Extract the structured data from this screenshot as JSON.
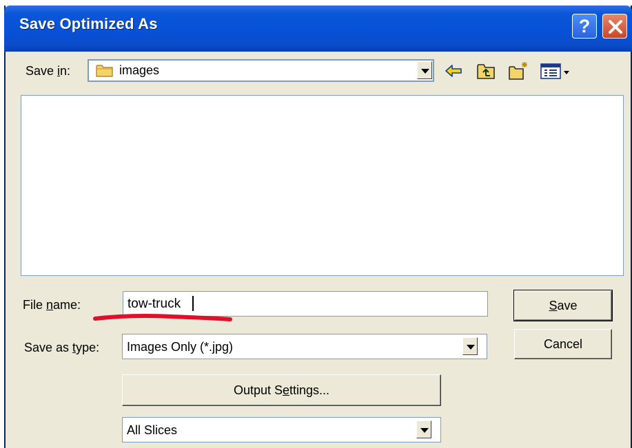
{
  "dialog": {
    "title": "Save Optimized As",
    "help_glyph": "?",
    "close_icon": "close-icon"
  },
  "save_in": {
    "label_pre": "Save ",
    "label_accel": "i",
    "label_post": "n:",
    "value": "images",
    "icon": "folder-icon"
  },
  "toolbar": {
    "icons": [
      "back-arrow-icon",
      "up-one-level-icon",
      "new-folder-icon",
      "view-menu-icon"
    ]
  },
  "file_name": {
    "label_pre": "File ",
    "label_accel": "n",
    "label_post": "ame:",
    "value": "tow-truck"
  },
  "save_as_type": {
    "label_pre": "Save as ",
    "label_accel": "t",
    "label_post": "ype:",
    "value": "Images Only (*.jpg)"
  },
  "buttons": {
    "save_accel": "S",
    "save_rest": "ave",
    "cancel": "Cancel",
    "output_pre": "Output S",
    "output_accel": "e",
    "output_post": "ttings..."
  },
  "slices": {
    "value": "All Slices"
  },
  "colors": {
    "titlebar": "#0751d6",
    "face": "#ece9d8",
    "annotation": "#e0102a"
  }
}
